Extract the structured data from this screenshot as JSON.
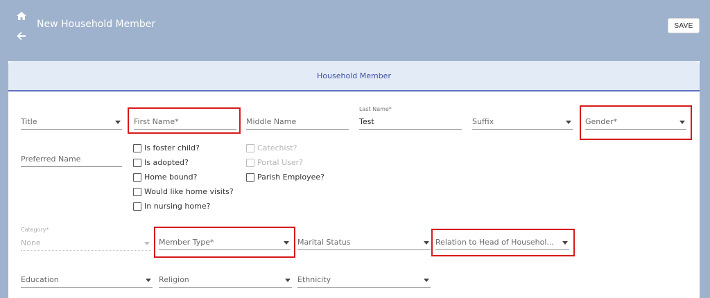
{
  "header": {
    "title": "New Household Member",
    "save_label": "SAVE",
    "icons": {
      "home": "home-icon",
      "back": "back-arrow-icon"
    }
  },
  "card": {
    "title": "Household Member"
  },
  "fields": {
    "title": {
      "label": "Title"
    },
    "first_name": {
      "label": "First Name*"
    },
    "middle_name": {
      "label": "Middle Name"
    },
    "last_name": {
      "label": "Last Name*",
      "value": "Test"
    },
    "suffix": {
      "label": "Suffix"
    },
    "gender": {
      "label": "Gender*"
    },
    "preferred_name": {
      "label": "Preferred Name"
    },
    "category": {
      "label": "Category*",
      "value": "None"
    },
    "member_type": {
      "label": "Member Type*"
    },
    "marital_status": {
      "label": "Marital Status"
    },
    "relation": {
      "label": "Relation to Head of Househol..."
    },
    "education": {
      "label": "Education"
    },
    "religion": {
      "label": "Religion"
    },
    "ethnicity": {
      "label": "Ethnicity"
    }
  },
  "checkboxes": {
    "foster": {
      "label": "Is foster child?",
      "checked": false
    },
    "adopted": {
      "label": "Is adopted?",
      "checked": false
    },
    "home_bound": {
      "label": "Home bound?",
      "checked": false
    },
    "home_visits": {
      "label": "Would like home visits?",
      "checked": false
    },
    "nursing_home": {
      "label": "In nursing home?",
      "checked": false
    },
    "catechist": {
      "label": "Catechist?",
      "checked": false,
      "disabled": true
    },
    "portal_user": {
      "label": "Portal User?",
      "checked": false,
      "disabled": true
    },
    "parish_employee": {
      "label": "Parish Employee?",
      "checked": false
    }
  },
  "colors": {
    "header_bg": "#9fb2cd",
    "card_header_bg": "#e2ebf6",
    "accent": "#3d4fa6",
    "highlight": "#d61a1a"
  }
}
